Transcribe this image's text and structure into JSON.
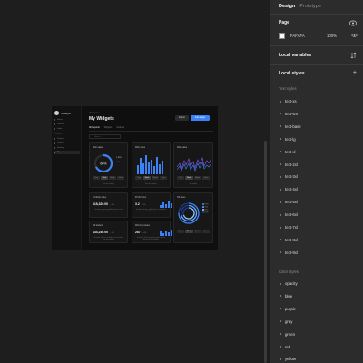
{
  "panel": {
    "tabs": [
      {
        "label": "Design",
        "active": true
      },
      {
        "label": "Prototype",
        "active": false
      }
    ],
    "page": {
      "title": "Page",
      "color_hex": "FAFAFA",
      "swatch_color": "#fafafa",
      "opacity": "100%"
    },
    "local_variables": {
      "title": "Local variables"
    },
    "local_styles": {
      "title": "Local styles",
      "add_label": "+",
      "text_styles_title": "Text styles",
      "text_styles": [
        "text-xs",
        "text-sm",
        "text-base",
        "text-lg",
        "text-xl",
        "text-2xl",
        "text-3xl",
        "text-4xl",
        "text-5xl",
        "text-6xl",
        "text-7xl",
        "text-8xl",
        "text-9xl"
      ],
      "color_styles_title": "Color styles",
      "color_styles": [
        "opacity",
        "blue",
        "purple",
        "gray",
        "green",
        "red",
        "yellow"
      ]
    }
  },
  "frame": {
    "logo": "Catalyst",
    "nav_items": [
      "Home",
      "Search",
      "Inbox"
    ],
    "nav_heading": "Favorites",
    "nav_items2": [
      "Projects",
      "Teams",
      "Settings",
      "Reports"
    ],
    "breadcrumb": "Workspace",
    "title": "My Widgets",
    "export_label": "Export",
    "add_label": "Add widget",
    "tabs": [
      {
        "label": "All Reports",
        "active": true
      },
      {
        "label": "Widgets",
        "active": false
      },
      {
        "label": "Settings",
        "active": false
      }
    ],
    "search_placeholder": "Search",
    "segments": [
      "Day",
      "Week",
      "Month",
      "Year"
    ],
    "cards": [
      {
        "title": "Web sales",
        "value": "",
        "delta": "",
        "center": "66%",
        "side": [
          "1,328",
          "44%"
        ],
        "foot": "Visualize all your web sales in one place with this widget."
      },
      {
        "title": "Web sales",
        "value": "",
        "delta": "",
        "foot": "Visualize all your web sales in one place with this widget."
      },
      {
        "title": "Web sales",
        "value": "",
        "delta": "",
        "foot": "Visualize all your web sales in one place with this widget."
      },
      {
        "title": "Portfolio value",
        "value": "$18,329.00",
        "delta": "+ 4%",
        "foot": "Visualize all your portfolio value in one place with this widget."
      },
      {
        "title": "Profit factor",
        "value": "3.2",
        "delta": "+ 2%",
        "foot": "Visualize all your profit factor in one place with this widget."
      },
      {
        "title": "Nft sales",
        "value": "",
        "delta": "",
        "legend": [
          "ETH",
          "SOL",
          "BTC",
          "DOT"
        ],
        "foot": ""
      },
      {
        "title": "Nft traders",
        "value": "$34,230.00",
        "delta": "+ 3%",
        "foot": "Visualize all your nft traders in one place with this widget."
      },
      {
        "title": "Winning trades",
        "value": "287",
        "delta": "+ 6%",
        "foot": "Visualize all your winning trades in one place with this widget."
      }
    ],
    "bars_a": [
      0.45,
      0.8,
      0.55,
      0.95,
      0.6,
      0.75,
      0.4,
      0.85,
      0.5,
      0.7
    ],
    "bars_small_a": [
      0.4,
      0.7,
      0.5,
      0.9,
      0.6
    ],
    "bars_small_b": [
      0.6,
      0.4,
      0.8,
      0.5,
      0.9
    ],
    "donut_pct": 0.66
  },
  "colors": {
    "accent": "#3b82f6",
    "panel_bg": "#2c2c2c",
    "canvas_bg": "#1e1e1e"
  }
}
